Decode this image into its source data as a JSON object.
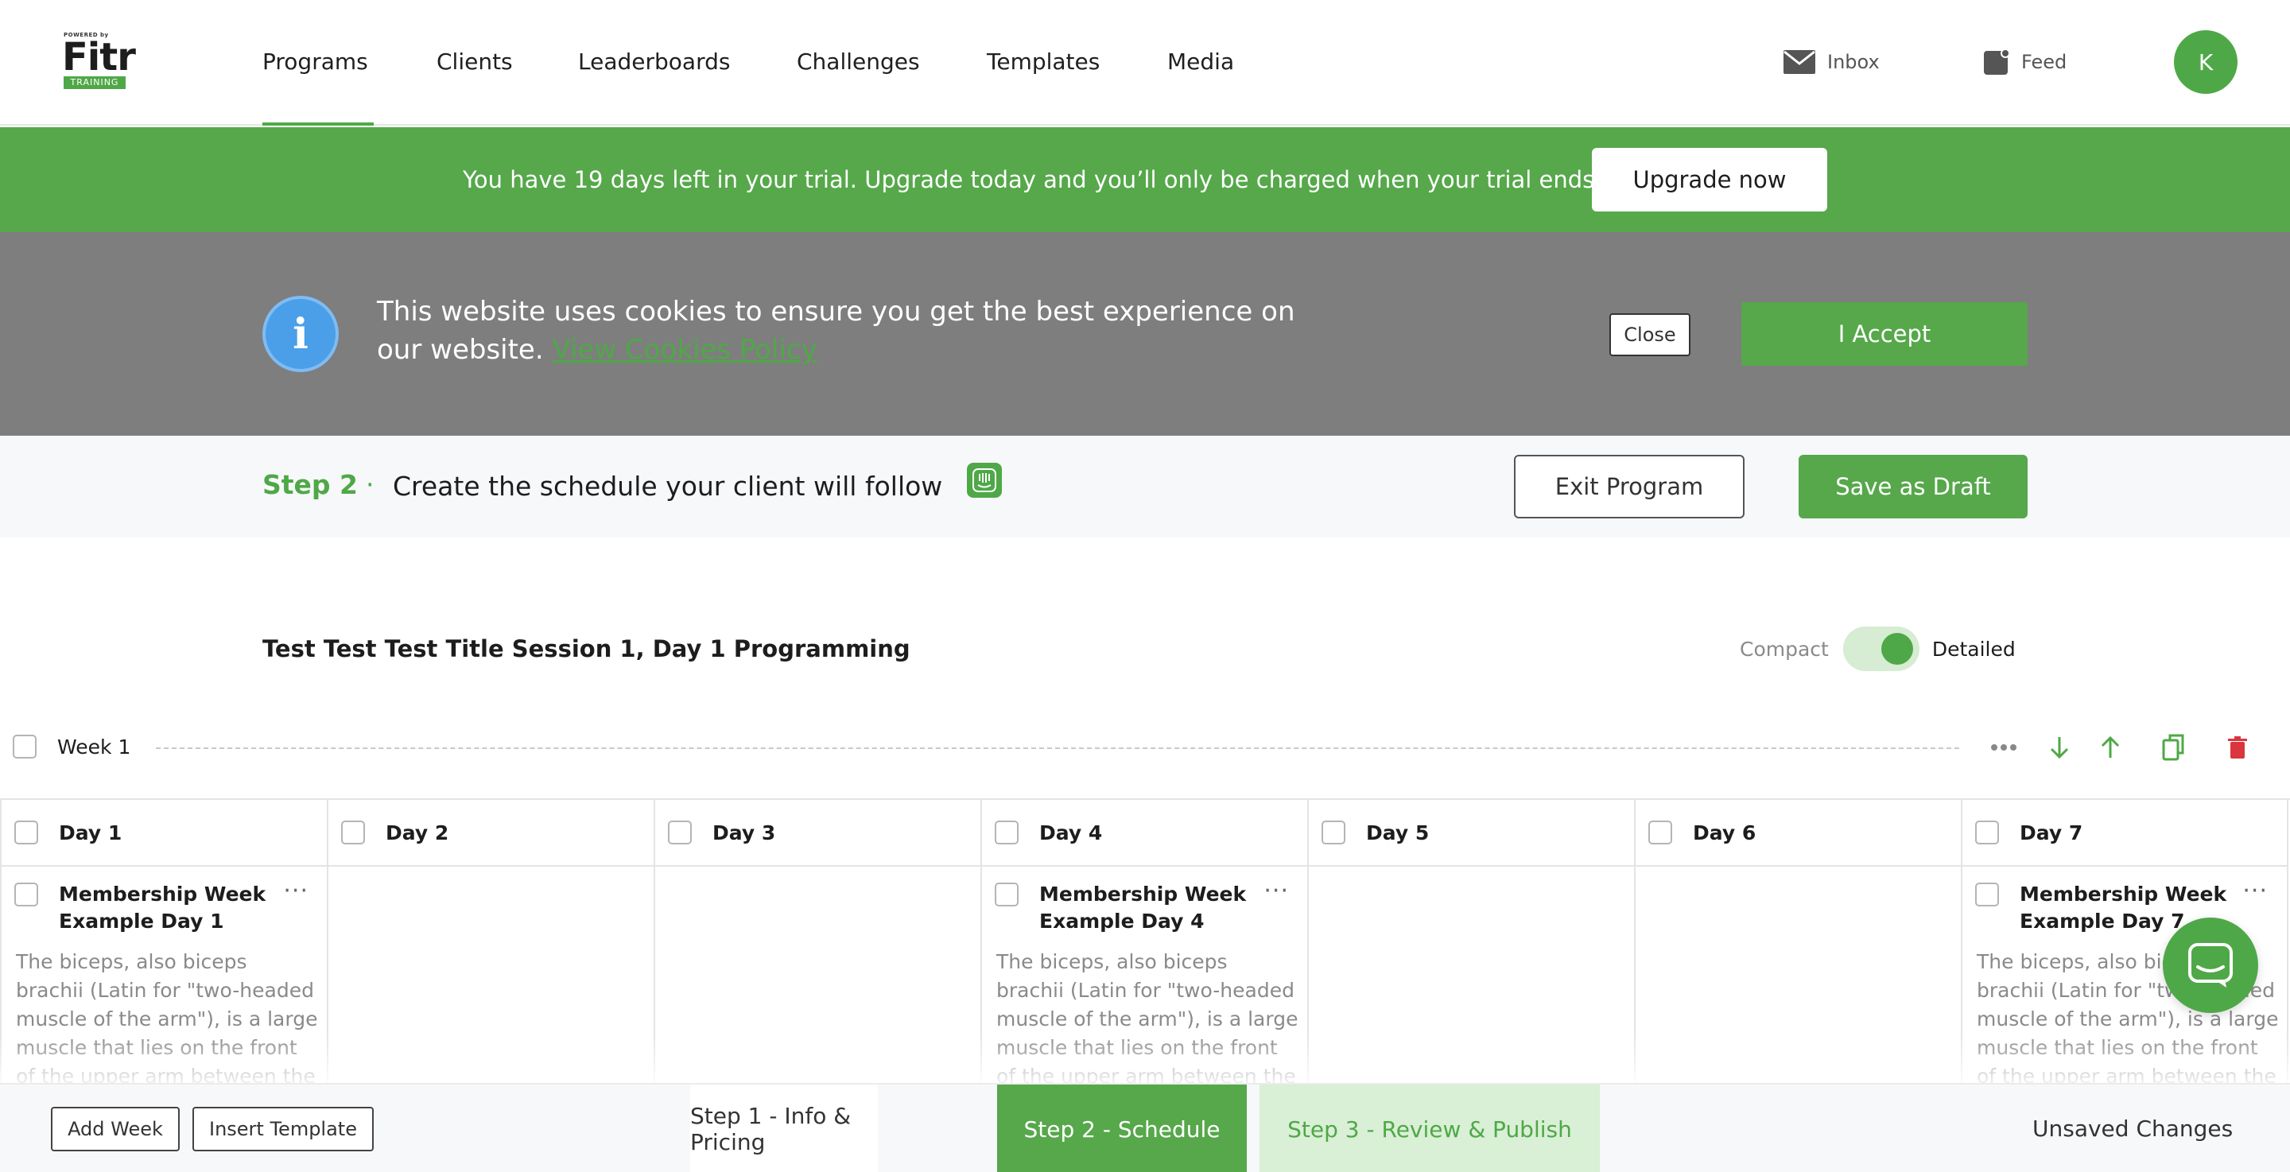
{
  "brand": {
    "powered": "POWERED by",
    "name": "Fitr",
    "sub": "TRAINING"
  },
  "nav": {
    "items": [
      "Programs",
      "Clients",
      "Leaderboards",
      "Challenges",
      "Templates",
      "Media"
    ],
    "active": "Programs",
    "inbox": "Inbox",
    "feed": "Feed",
    "avatar_initial": "K"
  },
  "trial": {
    "text": "You have 19 days left in your trial. Upgrade today and you’ll only be charged when your trial ends.",
    "button": "Upgrade now"
  },
  "cookie": {
    "text": "This website uses cookies to ensure you get the best experience on our website.",
    "link": "View Cookies Policy",
    "close": "Close",
    "accept": "I Accept"
  },
  "step": {
    "label": "Step 2",
    "dot": "·",
    "title": "Create the schedule your client will follow",
    "exit": "Exit Program",
    "save": "Save as Draft"
  },
  "program": {
    "title": "Test Test Test Title Session 1, Day 1 Programming",
    "compact": "Compact",
    "detailed": "Detailed",
    "detailed_on": true
  },
  "week": {
    "label": "Week 1"
  },
  "days": [
    {
      "label": "Day 1",
      "session": "Membership Week Example Day 1",
      "desc": "The biceps, also biceps brachii (Latin for \"two-headed muscle of the arm\"), is a large muscle that lies on the front of the upper arm between the"
    },
    {
      "label": "Day 2"
    },
    {
      "label": "Day 3"
    },
    {
      "label": "Day 4",
      "session": "Membership Week Example Day 4",
      "desc": "The biceps, also biceps brachii (Latin for \"two-headed muscle of the arm\"), is a large muscle that lies on the front of the upper arm between the"
    },
    {
      "label": "Day 5"
    },
    {
      "label": "Day 6"
    },
    {
      "label": "Day 7",
      "session": "Membership Week Example Day 7",
      "desc": "The biceps, also biceps brachii (Latin for \"two-headed muscle of the arm\"), is a large muscle that lies on the front of the upper arm between the"
    }
  ],
  "bottom": {
    "add_week": "Add Week",
    "insert_template": "Insert Template",
    "steps": [
      "Step 1 - Info & Pricing",
      "Step 2 - Schedule",
      "Step 3 - Review & Publish"
    ],
    "active_step": "Step 2 - Schedule",
    "status": "Unsaved Changes"
  },
  "colors": {
    "accent": "#56a84b",
    "info": "#4a9fe8",
    "danger": "#d9363e",
    "banner_gray": "#7e7e7e"
  },
  "icons": [
    "envelope-icon",
    "feed-icon",
    "info-icon",
    "intercom-icon",
    "more-icon",
    "arrow-down-icon",
    "arrow-up-icon",
    "copy-icon",
    "trash-icon",
    "chat-icon"
  ]
}
